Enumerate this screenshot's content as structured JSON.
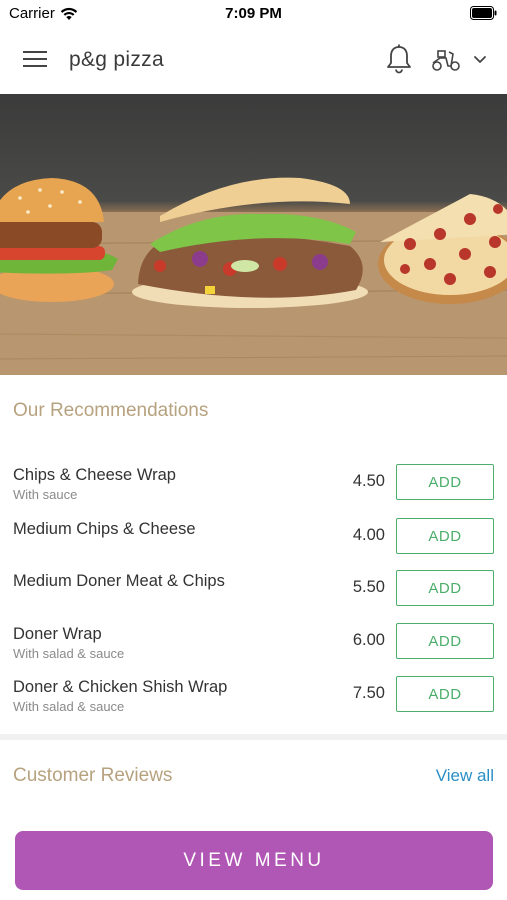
{
  "status_bar": {
    "carrier": "Carrier",
    "time": "7:09 PM",
    "wifi_icon": "wifi-icon",
    "battery_icon": "battery-icon"
  },
  "header": {
    "title": "p&g pizza",
    "menu_icon": "hamburger-menu-icon",
    "notification_icon": "bell-icon",
    "delivery_icon": "scooter-icon",
    "dropdown_icon": "chevron-down-icon"
  },
  "hero": {
    "image": "food-banner-burger-doner-pizza"
  },
  "recommendations": {
    "title": "Our Recommendations",
    "items": [
      {
        "name": "Chips & Cheese Wrap",
        "description": "With sauce",
        "price": "4.50",
        "action": "ADD"
      },
      {
        "name": "Medium Chips & Cheese",
        "description": "",
        "price": "4.00",
        "action": "ADD"
      },
      {
        "name": "Medium Doner Meat & Chips",
        "description": "",
        "price": "5.50",
        "action": "ADD"
      },
      {
        "name": "Doner Wrap",
        "description": "With salad & sauce",
        "price": "6.00",
        "action": "ADD"
      },
      {
        "name": "Doner & Chicken Shish Wrap",
        "description": "With salad & sauce",
        "price": "7.50",
        "action": "ADD"
      }
    ]
  },
  "reviews": {
    "title": "Customer Reviews",
    "view_all": "View all"
  },
  "footer": {
    "view_menu_label": "VIEW MENU"
  },
  "colors": {
    "accent_purple": "#b056b4",
    "add_green": "#4cae6a",
    "section_title_tan": "#b7a27f",
    "link_blue": "#2a8fc6"
  }
}
